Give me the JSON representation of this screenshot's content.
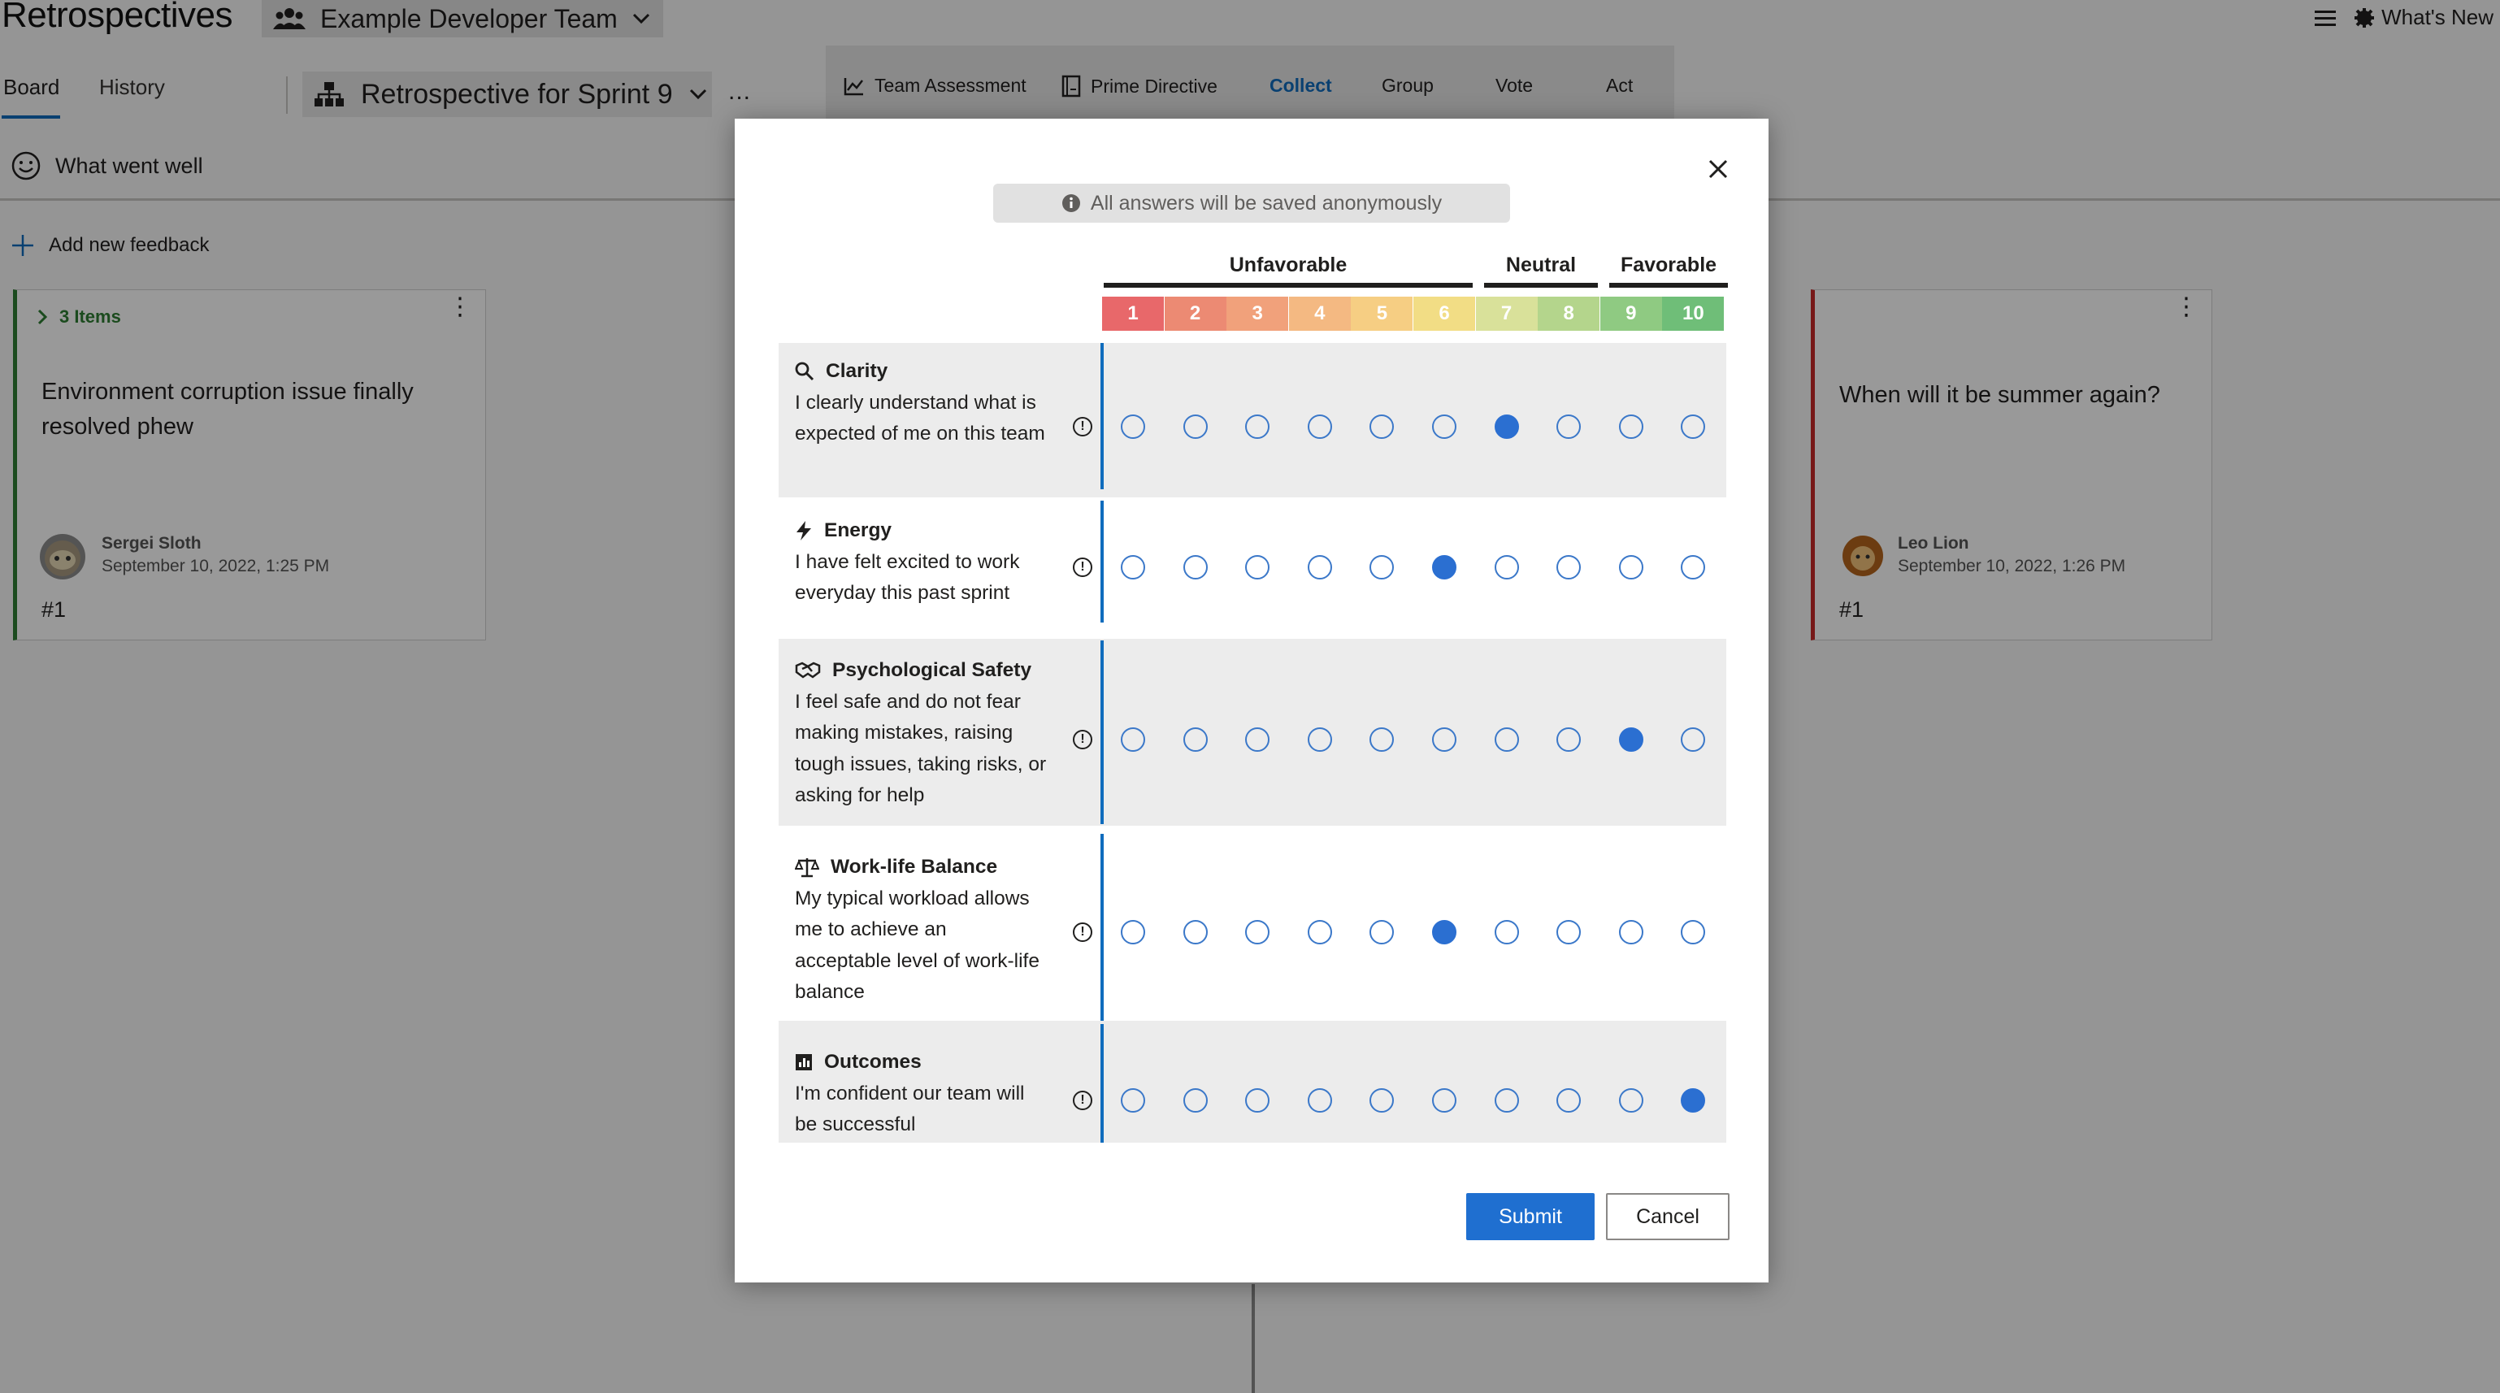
{
  "app": {
    "title": "Retrospectives"
  },
  "team": {
    "name": "Example Developer Team"
  },
  "top_right": {
    "whats_new": "What's New"
  },
  "nav": {
    "board": "Board",
    "history": "History"
  },
  "retro": {
    "name": "Retrospective for Sprint 9",
    "more": "..."
  },
  "phases": [
    {
      "label": "Team Assessment",
      "icon": "chart-icon"
    },
    {
      "label": "Prime Directive",
      "icon": "book-icon"
    },
    {
      "label": "Collect",
      "active": true
    },
    {
      "label": "Group"
    },
    {
      "label": "Vote"
    },
    {
      "label": "Act"
    }
  ],
  "column": {
    "header": "What went well",
    "add_feedback": "Add new feedback"
  },
  "card_left": {
    "group_count": "3 Items",
    "text": "Environment corruption issue finally resolved phew",
    "author": "Sergei Sloth",
    "date": "September 10, 2022, 1:25 PM",
    "number": "#1"
  },
  "card_right": {
    "text": "When will it be summer again?",
    "author": "Leo Lion",
    "date": "September 10, 2022, 1:26 PM",
    "number": "#1"
  },
  "modal": {
    "anonymous_note": "All answers will be saved anonymously",
    "groups": {
      "unfavorable": "Unfavorable",
      "neutral": "Neutral",
      "favorable": "Favorable"
    },
    "scale": [
      {
        "label": "1",
        "color": "#e8686a"
      },
      {
        "label": "2",
        "color": "#ec8a73"
      },
      {
        "label": "3",
        "color": "#f1a17b"
      },
      {
        "label": "4",
        "color": "#f4b982"
      },
      {
        "label": "5",
        "color": "#f6ce83"
      },
      {
        "label": "6",
        "color": "#f2dd85"
      },
      {
        "label": "7",
        "color": "#d9e19a"
      },
      {
        "label": "8",
        "color": "#b4d58c"
      },
      {
        "label": "9",
        "color": "#8fca82"
      },
      {
        "label": "10",
        "color": "#6fbe78"
      }
    ],
    "questions": [
      {
        "icon": "search-icon",
        "title": "Clarity",
        "description": "I clearly understand what is expected of me on this team",
        "selected": 7
      },
      {
        "icon": "lightning-icon",
        "title": "Energy",
        "description": "I have felt excited to work everyday this past sprint",
        "selected": 6
      },
      {
        "icon": "handshake-icon",
        "title": "Psychological Safety",
        "description": "I feel safe and do not fear making mistakes, raising tough issues, taking risks, or asking for help",
        "selected": 9
      },
      {
        "icon": "scales-icon",
        "title": "Work-life Balance",
        "description": "My typical workload allows me to achieve an acceptable level of work-life balance",
        "selected": 6
      },
      {
        "icon": "bar-chart-icon",
        "title": "Outcomes",
        "description": "I'm confident our team will be successful",
        "selected": 10
      }
    ],
    "submit": "Submit",
    "cancel": "Cancel"
  }
}
